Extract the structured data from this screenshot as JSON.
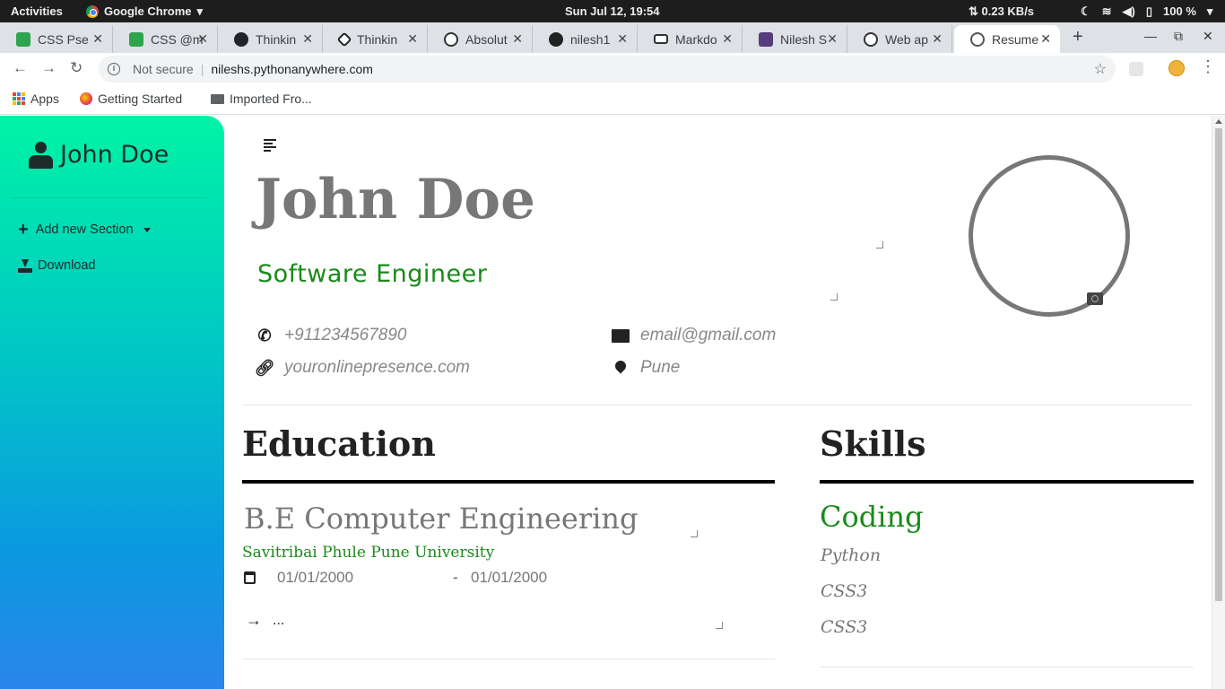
{
  "system_bar": {
    "activities": "Activities",
    "app_name": "Google Chrome",
    "clock": "Sun Jul 12, 19:54",
    "network_speed": "⇅ 0.23 KB/s",
    "battery": "100 %"
  },
  "tabs": [
    {
      "title": "CSS Pse",
      "favicon_color": "#2ea44f"
    },
    {
      "title": "CSS @m",
      "favicon_color": "#2ea44f"
    },
    {
      "title": "Thinkin",
      "favicon_color": "#20232a"
    },
    {
      "title": "Thinkin",
      "favicon_color": "#ffffff"
    },
    {
      "title": "Absolut",
      "favicon_color": "#ffffff"
    },
    {
      "title": "nilesh1",
      "favicon_color": "#ffffff"
    },
    {
      "title": "Markdo",
      "favicon_color": "#ffffff"
    },
    {
      "title": "Nilesh S",
      "favicon_color": "#563d7c"
    },
    {
      "title": "Web ap",
      "favicon_color": "#ffffff"
    },
    {
      "title": "Resume",
      "favicon_color": "#ffffff",
      "active": true
    }
  ],
  "address_bar": {
    "security_label": "Not secure",
    "url": "nileshs.pythonanywhere.com"
  },
  "bookmarks": [
    {
      "label": "Apps"
    },
    {
      "label": "Getting Started"
    },
    {
      "label": "Imported Fro..."
    }
  ],
  "sidebar": {
    "title": "John Doe",
    "items": [
      {
        "label": "Add new Section"
      },
      {
        "label": "Download"
      }
    ]
  },
  "resume": {
    "name": "John Doe",
    "role": "Software Engineer",
    "contact": {
      "phone": "+911234567890",
      "email": "email@gmail.com",
      "website": "youronlinepresence.com",
      "location": "Pune"
    },
    "education": {
      "heading": "Education",
      "degree": "B.E Computer Engineering",
      "university": "Savitribai Phule Pune University",
      "start_date": "01/01/2000",
      "date_separator": "-",
      "end_date": "01/01/2000",
      "description": "..."
    },
    "skills": {
      "heading": "Skills",
      "group_title": "Coding",
      "items": [
        "Python",
        "CSS3",
        "CSS3"
      ]
    }
  },
  "colors": {
    "accent_green": "#1a8a1a",
    "sidebar_gradient_top": "#00f3a6",
    "sidebar_gradient_bottom": "#2a85ea"
  }
}
